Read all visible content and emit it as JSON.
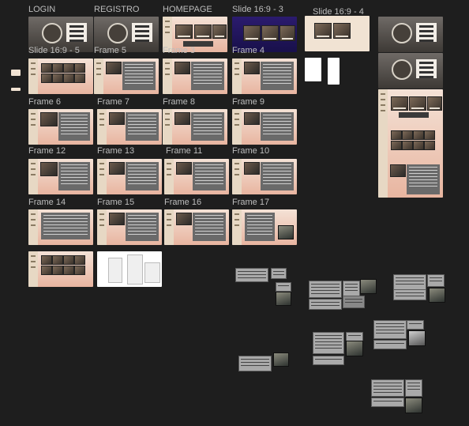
{
  "canvas": {
    "background": "#1e1e1e",
    "label_color": "#bdbdbd"
  },
  "frames": {
    "login": "LOGIN",
    "registro": "REGISTRO",
    "homepage": "HOMEPAGE",
    "slide3": "Slide 16:9 - 3",
    "slide4": "Slide 16:9 - 4",
    "slide5": "Slide 16:9 - 5",
    "f5": "Frame 5",
    "f3": "Frame 3",
    "f4": "Frame 4",
    "f6": "Frame 6",
    "f7": "Frame 7",
    "f8": "Frame 8",
    "f9": "Frame 9",
    "f12": "Frame 12",
    "f13": "Frame 13",
    "f11": "Frame 11",
    "f10": "Frame 10",
    "f14": "Frame 14",
    "f15": "Frame 15",
    "f16": "Frame 16",
    "f17": "Frame 17"
  }
}
